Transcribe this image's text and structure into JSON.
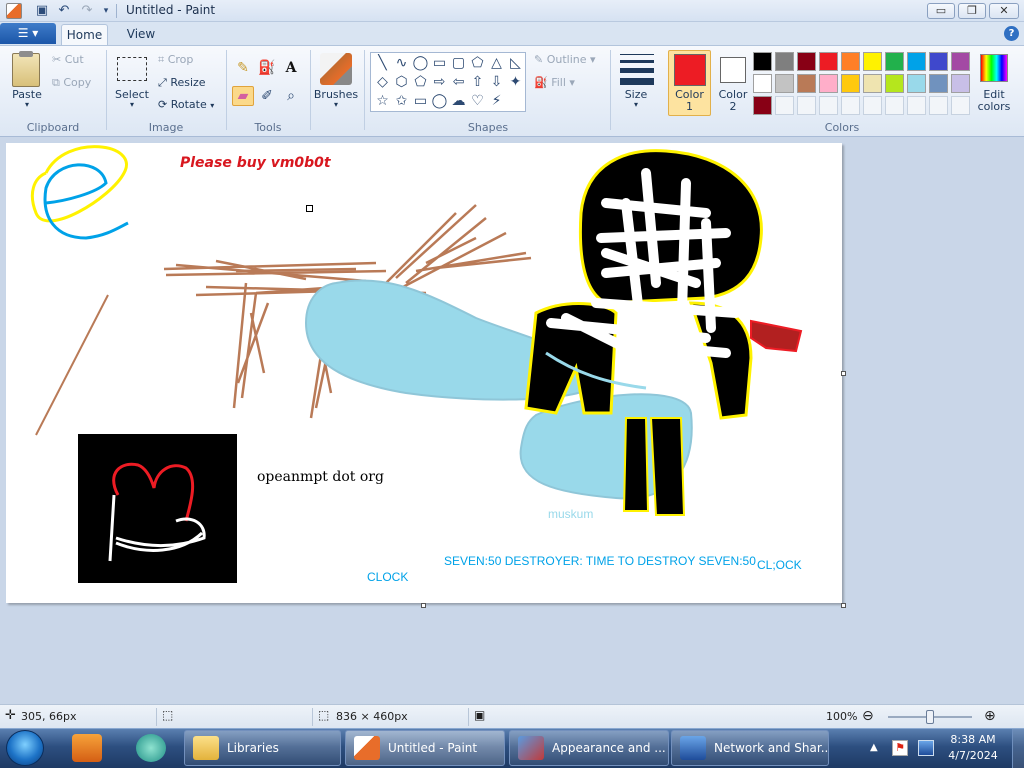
{
  "window": {
    "title": "Untitled - Paint",
    "minimize_glyph": "▭",
    "restore_glyph": "❐",
    "close_glyph": "✕"
  },
  "tabs": {
    "file_glyph": "☰ ▾",
    "home": "Home",
    "view": "View",
    "help_glyph": "?"
  },
  "clipboard": {
    "paste": "Paste",
    "cut": "Cut",
    "copy": "Copy",
    "group": "Clipboard"
  },
  "image": {
    "select": "Select",
    "crop": "Crop",
    "resize": "Resize",
    "rotate": "Rotate",
    "group": "Image"
  },
  "tools": {
    "group": "Tools",
    "text_glyph": "A"
  },
  "brushes": {
    "label": "Brushes"
  },
  "shapes": {
    "outline": "Outline",
    "fill": "Fill",
    "group": "Shapes",
    "glyphs": [
      "╲",
      "∿",
      "◯",
      "▭",
      "▢",
      "⬠",
      "△",
      "◺",
      "◇",
      "⬡",
      "⬠",
      "⇨",
      "⇦",
      "⇧",
      "⇩",
      "✦",
      "☆",
      "✩",
      "▭",
      "◯",
      "☁",
      "♡",
      "⚡"
    ]
  },
  "size": {
    "label": "Size"
  },
  "colors": {
    "color1_label": "Color\n1",
    "color1": "Color",
    "color1_n": "1",
    "color2": "Color",
    "color2_n": "2",
    "group": "Colors",
    "edit": "Edit",
    "edit2": "colors",
    "selected_color1": "#ed1c24",
    "selected_color2": "#ffffff",
    "palette": [
      "#000000",
      "#7f7f7f",
      "#880015",
      "#ed1c24",
      "#ff7f27",
      "#fff200",
      "#22b14c",
      "#00a2e8",
      "#3f48cc",
      "#a349a4",
      "#ffffff",
      "#c3c3c3",
      "#b97a57",
      "#ffaec9",
      "#ffc90e",
      "#efe4b0",
      "#b5e61d",
      "#99d9ea",
      "#7092be",
      "#c8bfe7",
      "#880015",
      "",
      "",
      "",
      "",
      "",
      "",
      "",
      "",
      ""
    ]
  },
  "canvas_text": {
    "heading": "Please buy vm0b0t",
    "site": "opeanmpt dot org",
    "muskum": "muskum",
    "destroyer": "SEVEN:50 DESTROYER: TIME TO DESTROY SEVEN:50",
    "clock_typo": "CL;OCK",
    "clock": "CLOCK"
  },
  "status": {
    "cursor": "305, 66px",
    "canvas_size": "836 × 460px",
    "zoom": "100%",
    "zoom_level": 0.5
  },
  "taskbar": {
    "libraries": "Libraries",
    "paint": "Untitled - Paint",
    "appearance": "Appearance and ...",
    "network": "Network and Shar...",
    "time": "8:38 AM",
    "date": "4/7/2024"
  }
}
